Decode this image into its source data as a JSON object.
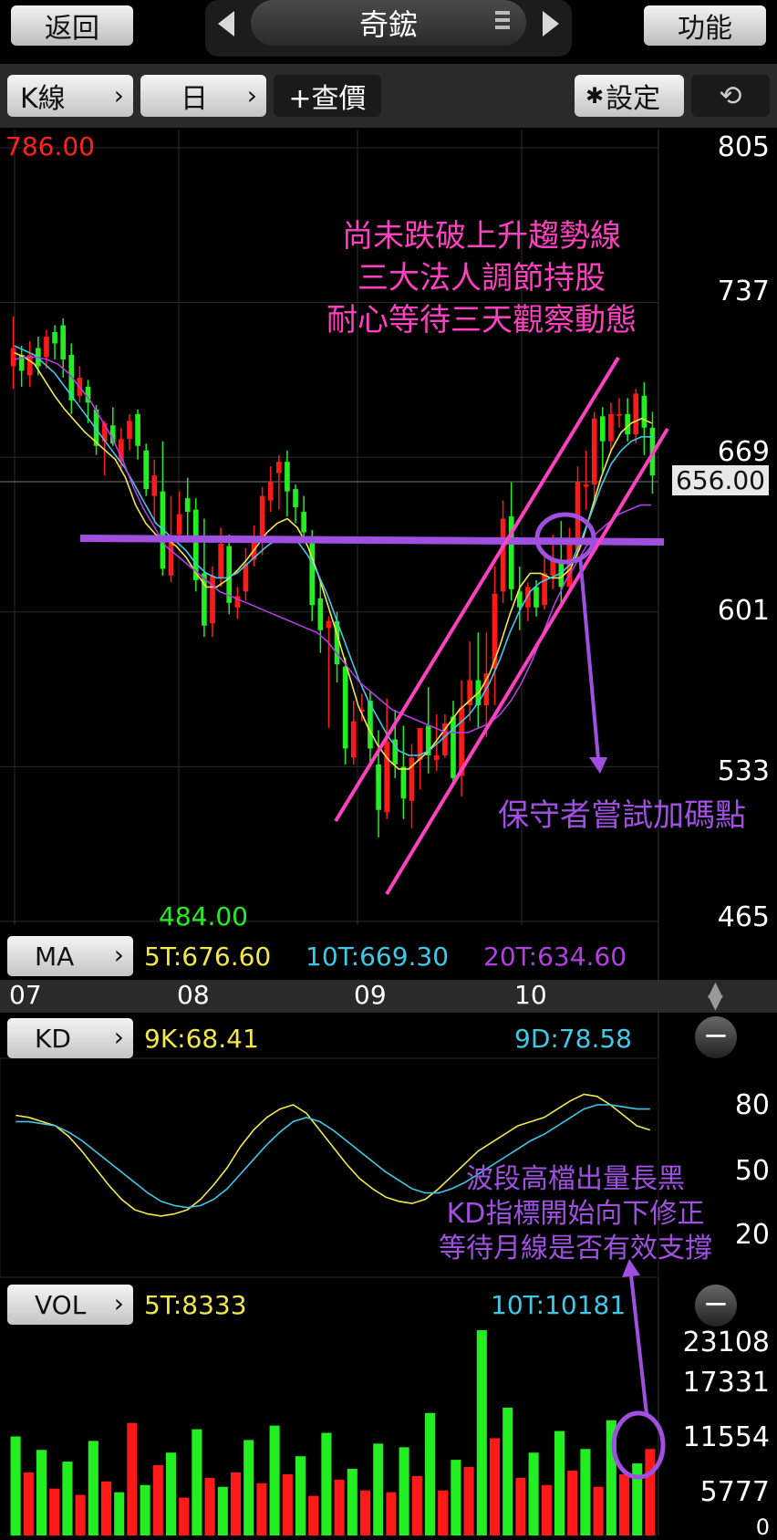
{
  "header": {
    "back_label": "返回",
    "title": "奇鋐",
    "menu_label": "功能"
  },
  "toolbar": {
    "period_label": "K線",
    "interval_label": "日",
    "add_quote_label": "+查價",
    "settings_label": "設定"
  },
  "price_panel": {
    "high_label": "786.00",
    "low_label": "484.00",
    "y_ticks": [
      "805",
      "737",
      "669",
      "601",
      "533",
      "465"
    ],
    "current_price": "656.00",
    "ma_label": "MA",
    "ma_values": [
      "5T:676.60",
      "10T:669.30",
      "20T:634.60"
    ]
  },
  "month_axis": [
    "07",
    "08",
    "09",
    "10"
  ],
  "kd_panel": {
    "label": "KD",
    "k_value": "9K:68.41",
    "d_value": "9D:78.58",
    "y_ticks": [
      "80",
      "50",
      "20"
    ]
  },
  "vol_panel": {
    "label": "VOL",
    "ma5": "5T:8333",
    "ma10": "10T:10181",
    "y_ticks": [
      "23108",
      "17331",
      "11554",
      "5777",
      "0"
    ]
  },
  "annotations": {
    "trend_text": [
      "尚未跌破上升趨勢線",
      "三大法人調節持股",
      "耐心等待三天觀察動態"
    ],
    "add_point_text": "保守者嘗試加碼點",
    "kd_text": [
      "波段高檔出量長黑",
      "KD指標開始向下修正",
      "等待月線是否有效支撐"
    ]
  },
  "colors": {
    "up": "#ff1a1a",
    "down": "#22ee22",
    "ma5": "#f2e84a",
    "ma10": "#40c8e8",
    "ma20": "#b040e0",
    "annotation_pink": "#ff40c0",
    "annotation_purple": "#a050e0"
  },
  "chart_data": {
    "type": "candlestick",
    "ylim": [
      465,
      805
    ],
    "candles": [
      [
        709,
        717,
        731,
        699
      ],
      [
        714,
        707,
        718,
        700
      ],
      [
        705,
        714,
        720,
        700
      ],
      [
        717,
        709,
        722,
        705
      ],
      [
        713,
        722,
        725,
        708
      ],
      [
        724,
        719,
        727,
        712
      ],
      [
        727,
        712,
        730,
        704
      ],
      [
        714,
        694,
        719,
        688
      ],
      [
        696,
        704,
        709,
        693
      ],
      [
        700,
        693,
        703,
        684
      ],
      [
        690,
        674,
        692,
        670
      ],
      [
        676,
        684,
        685,
        661
      ],
      [
        683,
        675,
        691,
        674
      ],
      [
        667,
        677,
        682,
        664
      ],
      [
        677,
        685,
        688,
        672
      ],
      [
        688,
        674,
        690,
        668
      ],
      [
        672,
        655,
        675,
        652
      ],
      [
        652,
        661,
        668,
        640
      ],
      [
        654,
        620,
        676,
        617
      ],
      [
        617,
        632,
        652,
        614
      ],
      [
        635,
        644,
        654,
        634
      ],
      [
        651,
        645,
        660,
        634
      ],
      [
        646,
        615,
        651,
        610
      ],
      [
        618,
        595,
        642,
        590
      ],
      [
        596,
        617,
        621,
        590
      ],
      [
        616,
        631,
        638,
        612
      ],
      [
        630,
        605,
        635,
        600
      ],
      [
        603,
        608,
        612,
        598
      ],
      [
        610,
        622,
        629,
        606
      ],
      [
        624,
        634,
        639,
        621
      ],
      [
        633,
        652,
        656,
        626
      ],
      [
        650,
        658,
        665,
        645
      ],
      [
        662,
        667,
        670,
        646
      ],
      [
        667,
        654,
        672,
        643
      ],
      [
        655,
        647,
        657,
        640
      ],
      [
        645,
        636,
        652,
        632
      ],
      [
        632,
        604,
        637,
        597
      ],
      [
        607,
        593,
        614,
        583
      ],
      [
        594,
        597,
        599,
        550
      ],
      [
        597,
        578,
        601,
        570
      ],
      [
        577,
        541,
        581,
        534
      ],
      [
        537,
        553,
        562,
        534
      ],
      [
        558,
        558,
        565,
        553
      ],
      [
        562,
        541,
        566,
        534
      ],
      [
        534,
        514,
        549,
        502
      ],
      [
        513,
        544,
        563,
        510
      ],
      [
        545,
        534,
        558,
        528
      ],
      [
        533,
        519,
        551,
        510
      ],
      [
        518,
        537,
        543,
        506
      ],
      [
        536,
        550,
        550,
        523
      ],
      [
        551,
        538,
        568,
        530
      ],
      [
        536,
        538,
        556,
        531
      ],
      [
        538,
        552,
        556,
        537
      ],
      [
        555,
        528,
        562,
        525
      ],
      [
        529,
        559,
        571,
        520
      ],
      [
        560,
        571,
        588,
        553
      ],
      [
        571,
        560,
        592,
        550
      ],
      [
        560,
        574,
        592,
        546
      ],
      [
        576,
        609,
        621,
        560
      ],
      [
        610,
        642,
        650,
        605
      ],
      [
        643,
        611,
        658,
        606
      ],
      [
        610,
        603,
        621,
        593
      ],
      [
        603,
        612,
        614,
        597
      ],
      [
        612,
        603,
        615,
        599
      ],
      [
        604,
        618,
        626,
        602
      ],
      [
        617,
        624,
        635,
        611
      ],
      [
        624,
        612,
        641,
        604
      ],
      [
        612,
        631,
        638,
        610
      ],
      [
        628,
        658,
        665,
        625
      ],
      [
        656,
        657,
        672,
        646
      ],
      [
        657,
        686,
        689,
        648
      ],
      [
        687,
        676,
        691,
        662
      ],
      [
        676,
        688,
        693,
        671
      ],
      [
        688,
        688,
        695,
        682
      ],
      [
        688,
        679,
        695,
        676
      ],
      [
        679,
        697,
        699,
        675
      ],
      [
        696,
        682,
        702,
        670
      ],
      [
        682,
        661,
        689,
        653
      ]
    ],
    "ma5": [
      715,
      713,
      710,
      703,
      696,
      690,
      685,
      680,
      676,
      672,
      668,
      660,
      648,
      640,
      635,
      633,
      630,
      625,
      618,
      612,
      612,
      615,
      619,
      624,
      630,
      636,
      640,
      642,
      638,
      630,
      618,
      604,
      590,
      575,
      560,
      550,
      542,
      536,
      532,
      532,
      536,
      540,
      546,
      552,
      558,
      562,
      566,
      574,
      586,
      600,
      612,
      618,
      618,
      616,
      616,
      620,
      630,
      645,
      660,
      672,
      680,
      684,
      686,
      684
    ],
    "ma10": [
      718,
      716,
      714,
      710,
      706,
      700,
      694,
      688,
      682,
      676,
      670,
      664,
      656,
      648,
      640,
      636,
      632,
      628,
      622,
      618,
      616,
      616,
      618,
      622,
      626,
      630,
      633,
      634,
      632,
      626,
      618,
      608,
      596,
      584,
      572,
      562,
      554,
      546,
      540,
      538,
      538,
      540,
      544,
      548,
      552,
      556,
      562,
      570,
      580,
      592,
      602,
      610,
      614,
      616,
      618,
      622,
      632,
      644,
      656,
      666,
      672,
      676,
      678,
      678
    ],
    "ma20": [
      712,
      713,
      713,
      712,
      710,
      706,
      700,
      694,
      686,
      678,
      668,
      656,
      646,
      638,
      630,
      626,
      622,
      618,
      614,
      610,
      608,
      606,
      604,
      602,
      600,
      598,
      596,
      594,
      592,
      588,
      582,
      576,
      570,
      566,
      562,
      558,
      556,
      554,
      552,
      550,
      548,
      548,
      548,
      550,
      552,
      556,
      562,
      570,
      580,
      592,
      604,
      614,
      622,
      630,
      636,
      640,
      644,
      646,
      648,
      648
    ],
    "kd_k": [
      75,
      74,
      72,
      70,
      65,
      58,
      50,
      42,
      35,
      30,
      28,
      27,
      28,
      30,
      35,
      42,
      50,
      60,
      68,
      74,
      78,
      80,
      76,
      68,
      60,
      52,
      45,
      40,
      36,
      34,
      33,
      35,
      40,
      46,
      52,
      58,
      62,
      66,
      70,
      72,
      74,
      78,
      82,
      85,
      84,
      80,
      75,
      70,
      68
    ],
    "kd_d": [
      72,
      72,
      71,
      70,
      67,
      63,
      58,
      53,
      48,
      43,
      38,
      34,
      32,
      31,
      32,
      35,
      40,
      47,
      54,
      61,
      67,
      72,
      74,
      72,
      68,
      63,
      58,
      53,
      48,
      44,
      40,
      38,
      38,
      40,
      43,
      47,
      51,
      55,
      59,
      63,
      66,
      70,
      74,
      78,
      80,
      80,
      79,
      78,
      78
    ],
    "volume": [
      11000,
      7000,
      9500,
      5200,
      8200,
      4500,
      10500,
      6000,
      4800,
      12500,
      5600,
      7800,
      9200,
      4200,
      11800,
      6400,
      5400,
      7000,
      10600,
      5800,
      12200,
      6800,
      8800,
      4400,
      11400,
      6200,
      7400,
      5000,
      10200,
      4800,
      9800,
      6600,
      13600,
      5000,
      8400,
      7600,
      22800,
      10800,
      14200,
      6400,
      9200,
      5600,
      11600,
      7200,
      9600,
      5400,
      12800,
      6800,
      8000,
      9600
    ]
  }
}
